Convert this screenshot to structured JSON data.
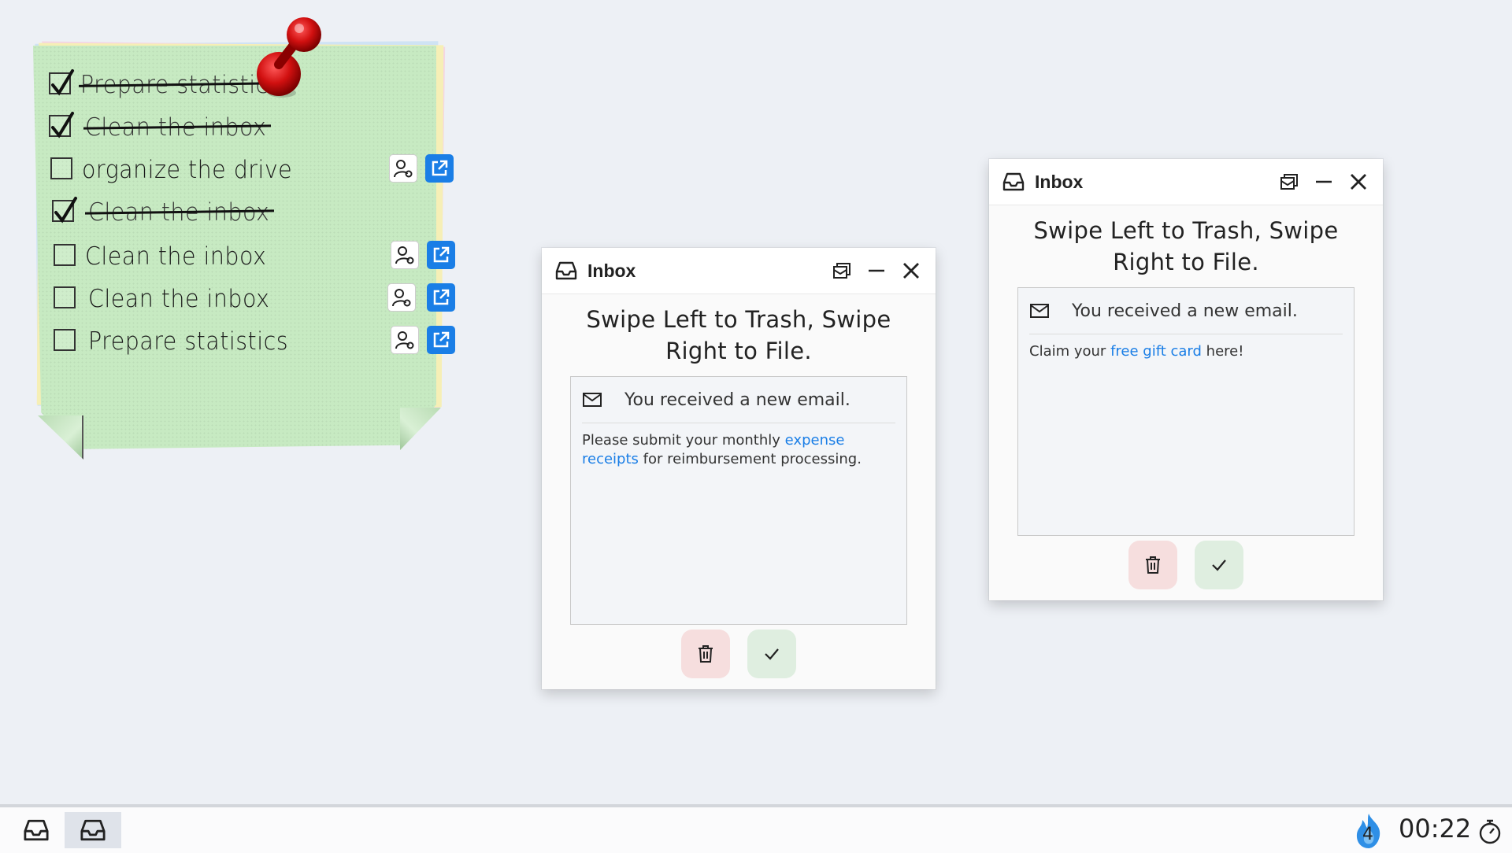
{
  "sticky_note": {
    "items": [
      {
        "label": "Prepare statistics",
        "done": true
      },
      {
        "label": "Clean the inbox",
        "done": true
      },
      {
        "label": "organize the drive",
        "done": false
      },
      {
        "label": "Clean the inbox",
        "done": true
      },
      {
        "label": "Clean the inbox",
        "done": false
      },
      {
        "label": "Clean the inbox",
        "done": false
      },
      {
        "label": "Prepare statistics",
        "done": false
      }
    ]
  },
  "windows": [
    {
      "title": "Inbox",
      "headline": "Swipe Left to Trash, Swipe Right to File.",
      "subject": "You received a new email.",
      "body_before": "Please submit your monthly ",
      "body_link": "expense receipts",
      "body_after": " for reimbursement processing."
    },
    {
      "title": "Inbox",
      "headline": "Swipe Left to Trash, Swipe Right to File.",
      "subject": "You received a new email.",
      "body_before": "Claim your ",
      "body_link": "free gift card",
      "body_after": " here!"
    }
  ],
  "taskbar": {
    "apps": [
      "inbox-icon",
      "inbox-icon"
    ],
    "streak_count": "4",
    "clock": "00:22"
  },
  "colors": {
    "note": "#c7eac2",
    "link": "#1a7ee6",
    "trash_bg": "#f6dede",
    "file_bg": "#dfeee0"
  }
}
